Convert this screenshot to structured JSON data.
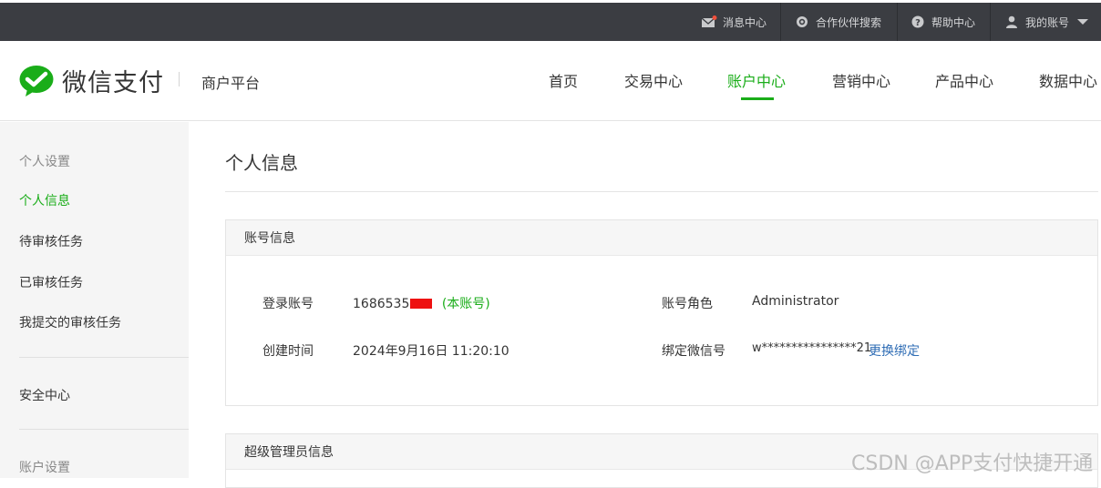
{
  "topbar": {
    "messages": "消息中心",
    "partner_search": "合作伙伴搜索",
    "help": "帮助中心",
    "account": "我的账号"
  },
  "header": {
    "brand": "微信支付",
    "subtitle": "商户平台",
    "nav": [
      "首页",
      "交易中心",
      "账户中心",
      "营销中心",
      "产品中心",
      "数据中心"
    ],
    "active_nav": "账户中心",
    "brand_color": "#1aad19"
  },
  "sidebar": {
    "group_personal": "个人设置",
    "items": [
      "个人信息",
      "待审核任务",
      "已审核任务",
      "我提交的审核任务"
    ],
    "active_item": "个人信息",
    "security": "安全中心",
    "group_account": "账户设置"
  },
  "main": {
    "title": "个人信息",
    "account_panel": {
      "title": "账号信息",
      "login_label": "登录账号",
      "login_value": "1686535",
      "login_tag": "(本账号)",
      "role_label": "账号角色",
      "role_value": "Administrator",
      "created_label": "创建时间",
      "created_value": "2024年9月16日 11:20:10",
      "wechat_label": "绑定微信号",
      "wechat_value": "w****************21",
      "change_bind": "更换绑定"
    },
    "admin_panel": {
      "title": "超级管理员信息"
    }
  },
  "watermark": "CSDN @APP支付快捷开通"
}
